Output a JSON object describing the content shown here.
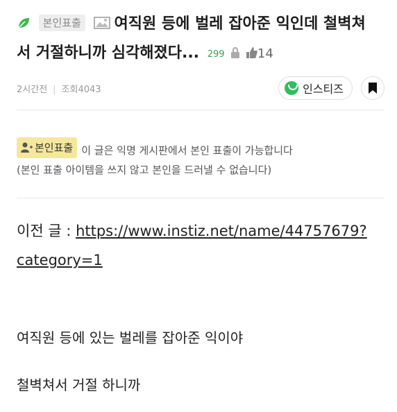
{
  "post": {
    "badge_label": "본인표출",
    "title_part1": "여직원 등에 벌레 잡아준 익인데 철벽쳐",
    "title_part2": "서 거절하니까 심각해졌다...",
    "view_count_small": "299",
    "likes": "14",
    "time_ago": "2시간전",
    "views_label": "조회4043"
  },
  "brand": {
    "button_label": "인스티즈"
  },
  "notice": {
    "badge_label": "본인표출",
    "line1": "이 글은 익명 게시판에서 본인 표출이 가능합니다",
    "line2": "(본인 표출 아이템을 쓰지 않고 본인을 드러낼 수 없습니다)"
  },
  "content": {
    "prev_prefix": "이전 글 : ",
    "prev_link_line1": "https://www.instiz.net/name/44757679?",
    "prev_link_line2": "category=1",
    "para1": "여직원 등에 있는 벌레를 잡아준 익이야",
    "para2": "철벽쳐서 거절 하니까"
  },
  "colors": {
    "accent_green": "#2fbf5c",
    "notice_badge_bg": "#f5e79c"
  },
  "icons": {
    "leaf": "leaf-icon",
    "picture": "picture-icon",
    "lock": "lock-icon",
    "thumb": "thumbs-up-icon",
    "bookmark": "bookmark-icon",
    "person": "person-icon"
  }
}
